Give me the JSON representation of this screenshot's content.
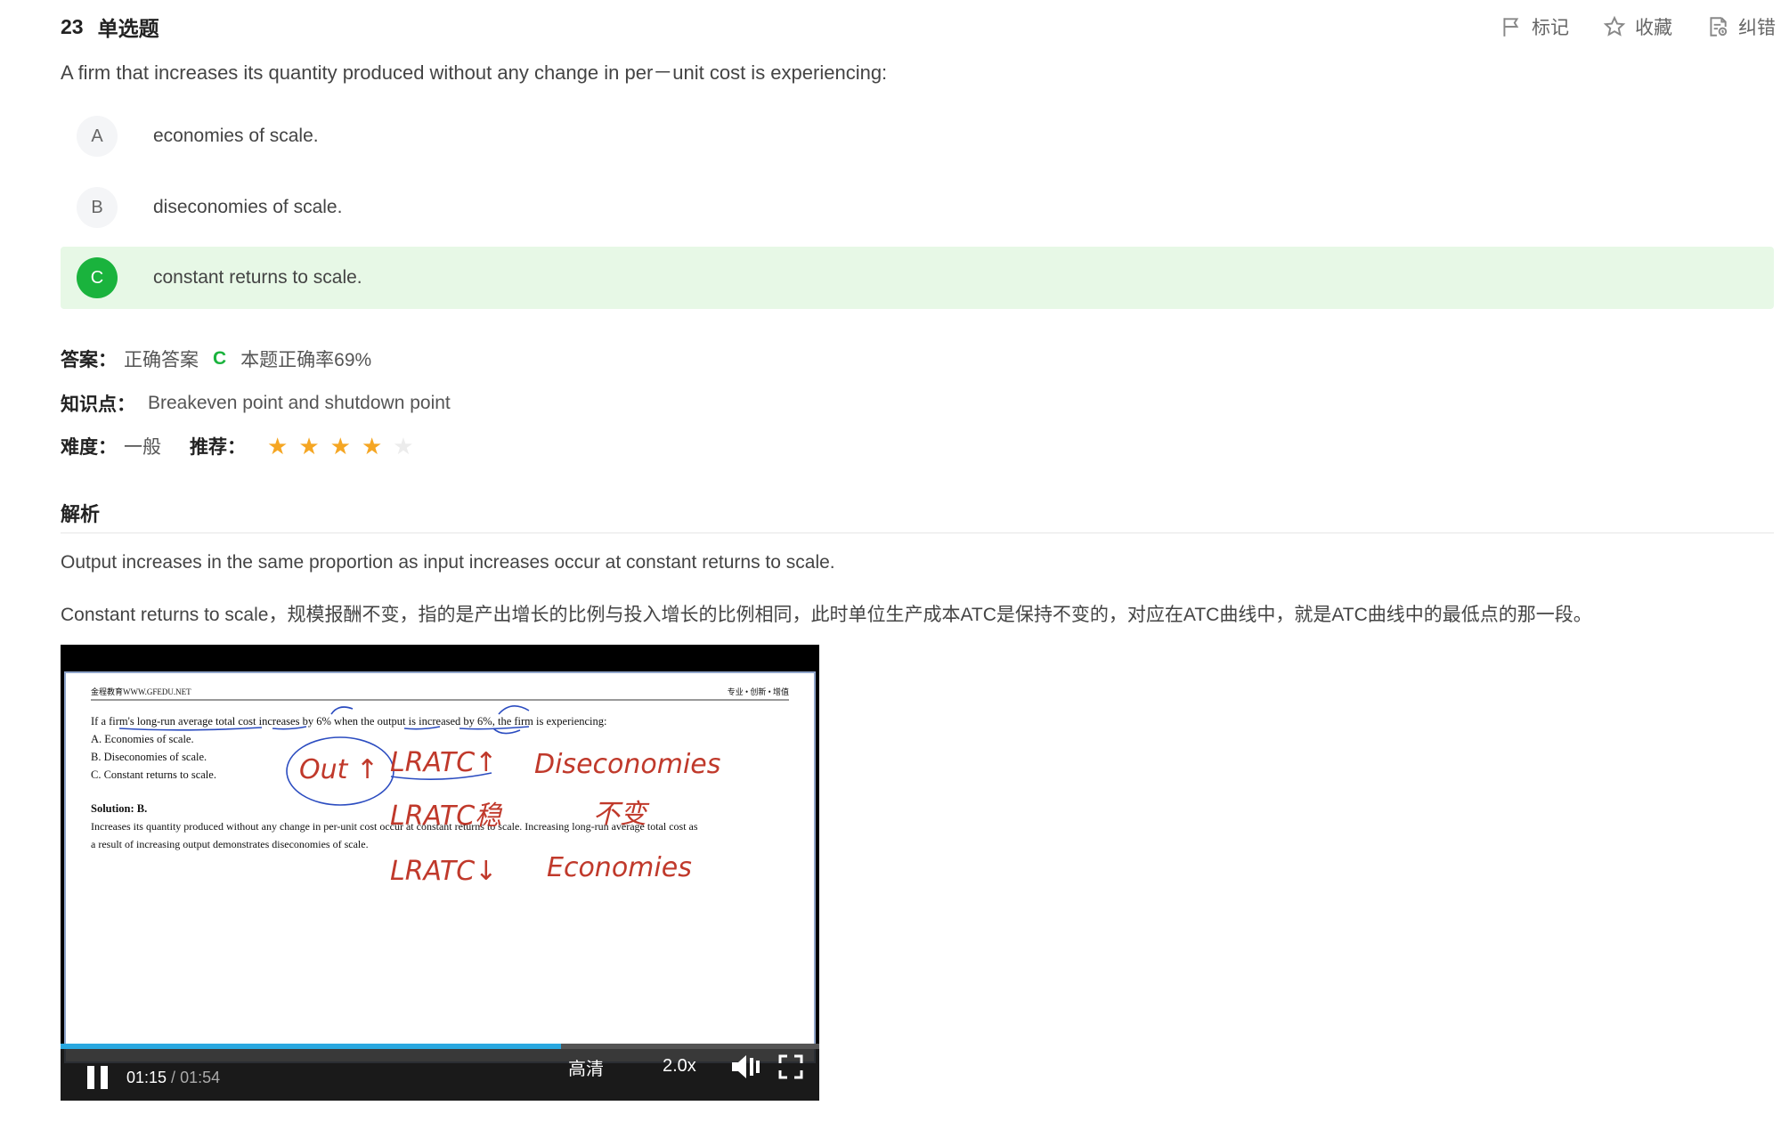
{
  "question": {
    "number": "23",
    "type": "单选题",
    "text": "A firm that increases its quantity produced without any change in per－unit cost is experiencing:"
  },
  "tools": {
    "mark": "标记",
    "favorite": "收藏",
    "report": "纠错"
  },
  "options": [
    {
      "letter": "A",
      "text": "economies of scale."
    },
    {
      "letter": "B",
      "text": "diseconomies of scale."
    },
    {
      "letter": "C",
      "text": "constant returns to scale."
    }
  ],
  "answer": {
    "label": "答案：",
    "prefix": "正确答案",
    "letter": "C",
    "rate": "本题正确率69%"
  },
  "knowledge": {
    "label": "知识点：",
    "value": "Breakeven point and shutdown point"
  },
  "difficulty": {
    "label": "难度：",
    "value": "一般",
    "recommend_label": "推荐：",
    "stars_filled": 4,
    "stars_total": 5
  },
  "analysis": {
    "title": "解析",
    "p1": "Output increases in the same proportion as input increases occur at constant returns to scale.",
    "p2": "Constant returns to scale，规模报酬不变，指的是产出增长的比例与投入增长的比例相同，此时单位生产成本ATC是保持不变的，对应在ATC曲线中，就是ATC曲线中的最低点的那一段。"
  },
  "video": {
    "slide": {
      "header_left": "金程教育WWW.GFEDU.NET",
      "header_right": "专业 • 创新 • 增值",
      "question": "If a firm's long-run average total cost increases by 6% when the output is increased by 6%, the firm is experiencing:",
      "opt_a": "A.  Economies of scale.",
      "opt_b": "B.  Diseconomies of scale.",
      "opt_c": "C.  Constant returns to scale.",
      "solution_title": "Solution: B.",
      "solution_1": "Increases its quantity produced without any change in per-unit cost occur at constant returns to scale. Increasing long-run average total cost as",
      "solution_2": "a result of increasing output demonstrates diseconomies of scale.",
      "ink_out": "Out ↑",
      "ink_lratc_up": "LRATC↑",
      "ink_diseconomies": "Diseconomies",
      "ink_lratc_stable": "LRATC稳",
      "ink_stable": "不变",
      "ink_lratc_down": "LRATC↓",
      "ink_economies": "Economies"
    },
    "current_time": "01:15",
    "duration": "01:54",
    "progress": 0.66,
    "quality": "高清",
    "speed": "2.0x"
  },
  "colors": {
    "correct": "#1ab33d",
    "correct_bg": "#e7f8e6",
    "star": "#f5a623",
    "ink_red": "#c0392b",
    "ink_blue": "#2b4cc0",
    "progress": "#29a8e0"
  }
}
